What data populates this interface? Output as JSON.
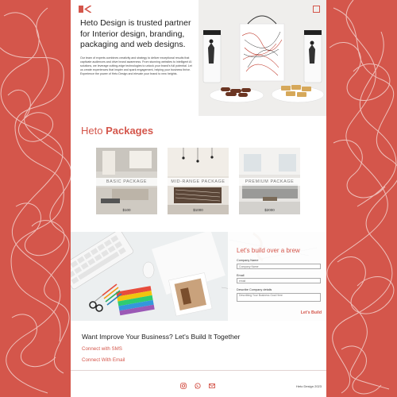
{
  "hero": {
    "title": "Heto Design is trusted partner for Interior design, branding, packaging and web designs.",
    "body": "Our team of experts combines creativity and strategy to deliver exceptional results that captivate audiences and drive brand awareness. From stunning websites to intelligent AI solutions, we leverage cutting-edge technologies to unlock your brand's full potential. Let us create experiences that inspire and spark engagement, helping your business thrive. Experience the power of Heto Design and elevate your brand to new heights."
  },
  "packages": {
    "heading_light": "Heto ",
    "heading_bold": "Packages",
    "items": [
      {
        "label": "BASIC PACKAGE",
        "price": "$100"
      },
      {
        "label": "MID-RANGE PACKAGE",
        "price": "$1000"
      },
      {
        "label": "PREMIUM PACKAGE",
        "price": "$2000"
      }
    ]
  },
  "contact_form": {
    "title": "Let's build over a brew",
    "company_label": "Company Name",
    "company_placeholder": "Company Name",
    "email_label": "Email",
    "email_placeholder": "email",
    "describe_label": "Describe Company details",
    "describe_placeholder": "Describing Your Business Goal Here",
    "submit_label": "Let's Build"
  },
  "cta": {
    "title_part1": "Want Improve Your Business? ",
    "title_part2": "Let's Build It Together",
    "link_sms": "Connect with SMS",
    "link_email": "Connect With Email"
  },
  "footer": {
    "copyright": "Heto Design 2023",
    "social_icons": [
      "instagram-icon",
      "whatsapp-icon",
      "mail-icon"
    ]
  },
  "colors": {
    "brand": "#d4564b",
    "background": "#d4564b",
    "page": "#ffffff"
  }
}
